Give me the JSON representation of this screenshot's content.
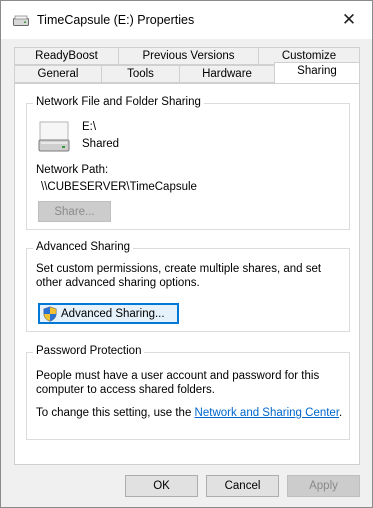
{
  "window": {
    "title": "TimeCapsule (E:) Properties",
    "close_glyph": "✕"
  },
  "tabs": {
    "row1": [
      "ReadyBoost",
      "Previous Versions",
      "Customize"
    ],
    "row2": [
      "General",
      "Tools",
      "Hardware",
      "Sharing"
    ],
    "active": "Sharing"
  },
  "network_sharing": {
    "heading": "Network File and Folder Sharing",
    "drive_name": "E:\\",
    "drive_status": "Shared",
    "path_label": "Network Path:",
    "path_value": "\\\\CUBESERVER\\TimeCapsule",
    "share_button": "Share..."
  },
  "advanced_sharing": {
    "heading": "Advanced Sharing",
    "description": "Set custom permissions, create multiple shares, and set other advanced sharing options.",
    "button": "Advanced Sharing..."
  },
  "password_protection": {
    "heading": "Password Protection",
    "description": "People must have a user account and password for this computer to access shared folders.",
    "change_text": "To change this setting, use the ",
    "link_text": "Network and Sharing Center",
    "period": "."
  },
  "footer": {
    "ok": "OK",
    "cancel": "Cancel",
    "apply": "Apply"
  },
  "colors": {
    "link": "#0066cc",
    "focus_border": "#0078d7"
  }
}
